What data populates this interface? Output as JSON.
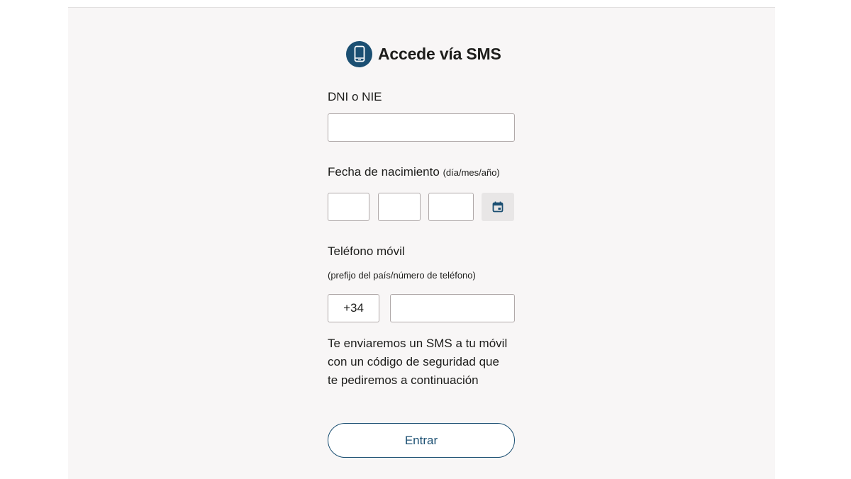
{
  "header": {
    "title": "Accede vía SMS",
    "icon": "mobile-phone-icon"
  },
  "form": {
    "dni_label": "DNI o NIE",
    "dni_value": "",
    "birth_label": "Fecha de nacimiento",
    "birth_hint": "(día/mes/año)",
    "birth_day": "",
    "birth_month": "",
    "birth_year": "",
    "calendar_icon": "calendar-icon",
    "phone_label": "Teléfono móvil",
    "phone_hint": "(prefijo del país/número de teléfono)",
    "phone_prefix": "+34",
    "phone_number": "",
    "info_lines": [
      "Te enviaremos un SMS a tu móvil",
      "con un código de seguridad que",
      "te pediremos a continuación"
    ],
    "submit_label": "Entrar"
  },
  "colors": {
    "accent": "#1b4f72",
    "panel_bg": "#f8f6f6",
    "input_border": "#b0a9a9"
  }
}
